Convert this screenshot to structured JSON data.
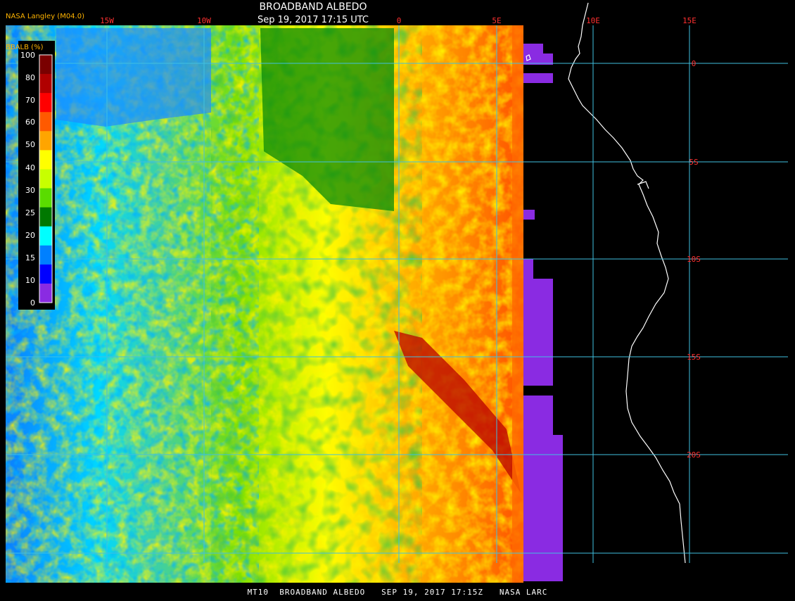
{
  "header": {
    "title": "BROADBAND ALBEDO",
    "subtitle": "Sep 19, 2017 17:15 UTC",
    "producer": "NASA Langley (M04.0)"
  },
  "footer": {
    "text": "MT10  BROADBAND ALBEDO   SEP 19, 2017 17:15Z   NASA LARC"
  },
  "legend": {
    "label": "BBALB (%)",
    "ticks": [
      "100",
      "90",
      "80",
      "70",
      "60",
      "50",
      "45",
      "40",
      "35",
      "30",
      "25",
      "20",
      "15",
      "10",
      "5",
      "0"
    ],
    "tick_labels_shown": [
      "100",
      "80",
      "70",
      "60",
      "50",
      "40",
      "30",
      "25",
      "20",
      "15",
      "10",
      "0"
    ],
    "colors": [
      "#7a0000",
      "#b00000",
      "#ff0000",
      "#ff5a00",
      "#ffa500",
      "#ffff00",
      "#c8ff00",
      "#5adc00",
      "#007800",
      "#00ffff",
      "#0080ff",
      "#0000ff",
      "#8a2be2"
    ]
  },
  "map": {
    "longitude_labels": [
      "15W",
      "10W",
      "0",
      "5E",
      "10E",
      "15E"
    ],
    "latitude_labels": [
      "0",
      "5S",
      "10S",
      "15S",
      "20S"
    ],
    "colors": {
      "grid": "#40c0e0",
      "coast": "#ffffff",
      "label": "#ff3030",
      "nodata": "#8a2be2"
    }
  }
}
